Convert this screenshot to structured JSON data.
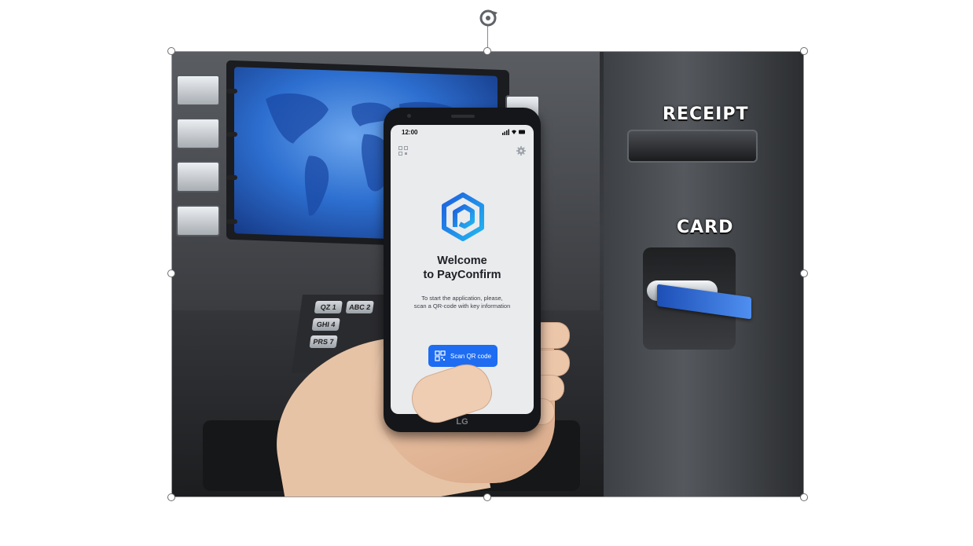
{
  "atm": {
    "receipt_label": "RECEIPT",
    "card_label": "CARD",
    "keypad": [
      {
        "letters": "QZ",
        "digit": "1"
      },
      {
        "letters": "ABC",
        "digit": "2"
      },
      {
        "letters": "GHI",
        "digit": "4"
      },
      {
        "letters": "PRS",
        "digit": "7"
      }
    ]
  },
  "phone": {
    "status_time": "12:00",
    "brand": "LG",
    "welcome_line1": "Welcome",
    "welcome_line2": "to PayConfirm",
    "description_line1": "To start the application, please,",
    "description_line2": "scan a QR-code with key information",
    "scan_button_label": "Scan QR code"
  },
  "colors": {
    "accent": "#1e6cf2",
    "screen_bg": "#e9ebed"
  }
}
